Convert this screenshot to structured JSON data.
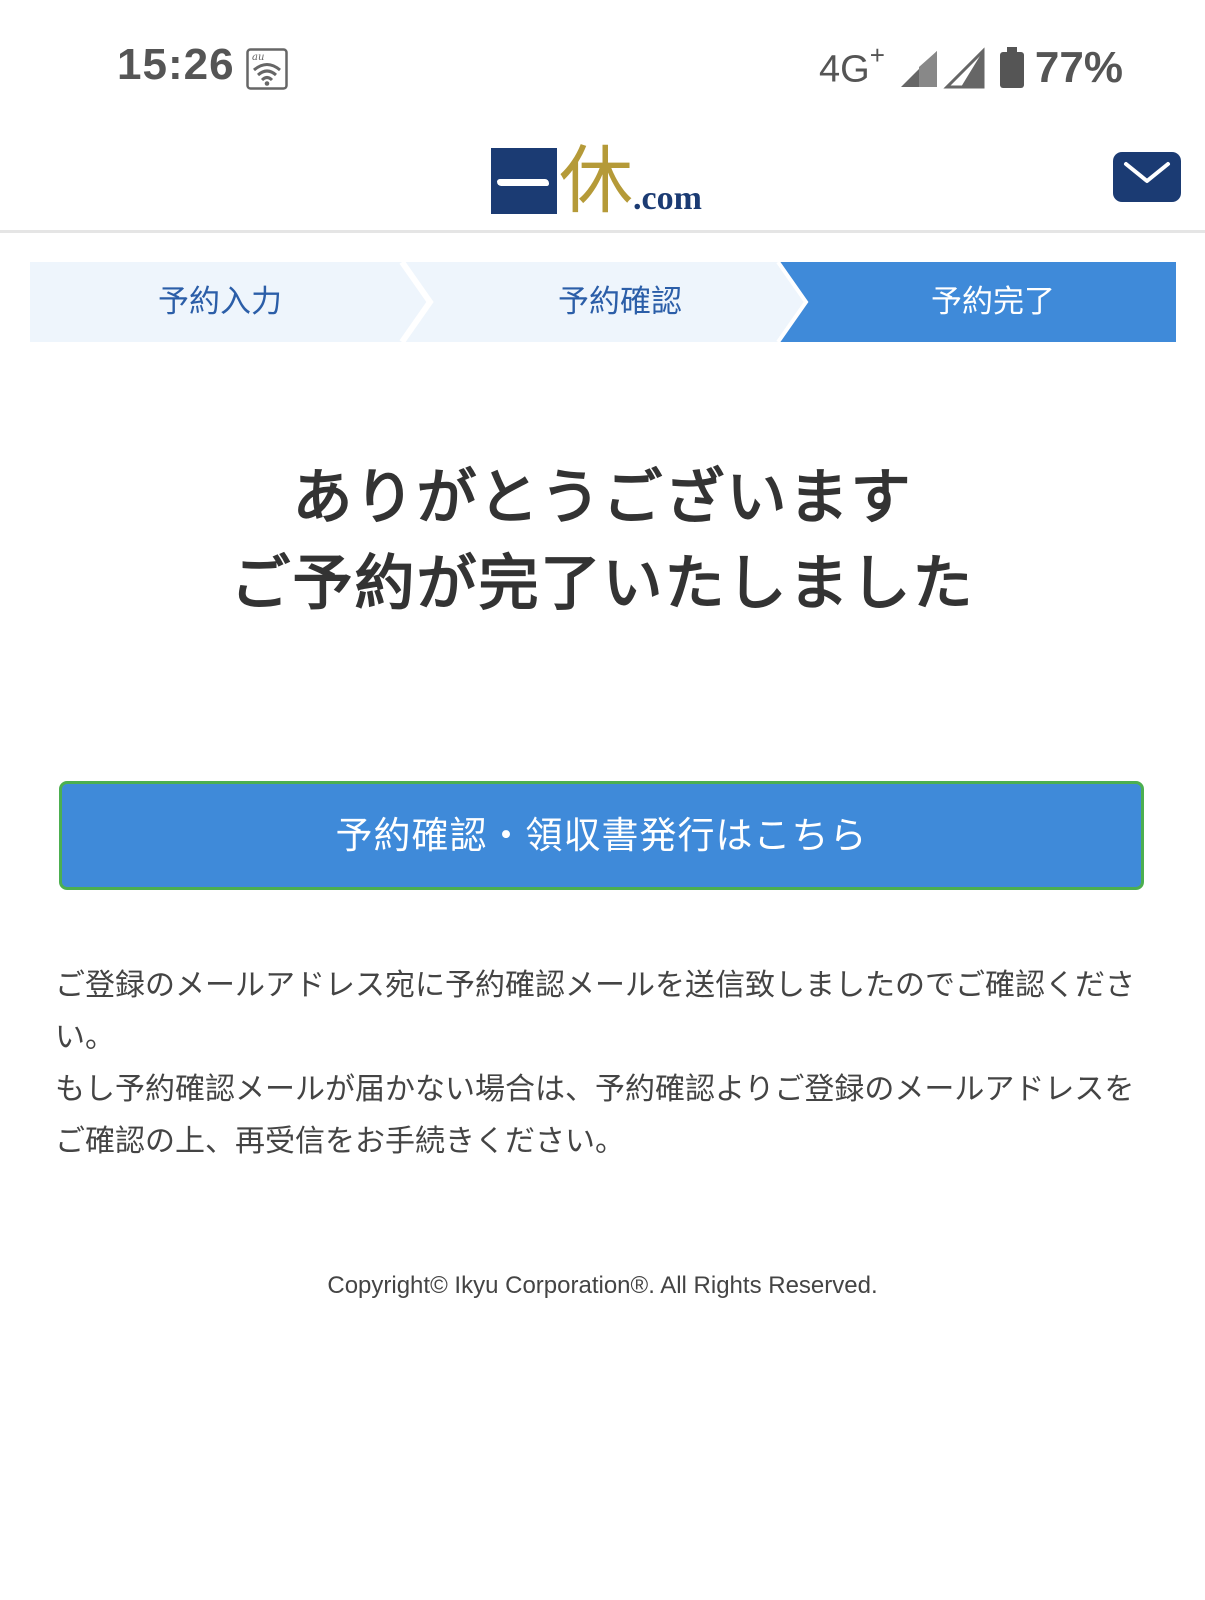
{
  "status_bar": {
    "time": "15:26",
    "carrier_badge": "au",
    "network": "4G",
    "network_plus": "+",
    "battery": "77%"
  },
  "header": {
    "logo": {
      "kanji": "休",
      "suffix": ".com"
    },
    "mail_icon": "envelope-icon"
  },
  "steps": [
    {
      "label": "予約入力",
      "active": false
    },
    {
      "label": "予約確認",
      "active": false
    },
    {
      "label": "予約完了",
      "active": true
    }
  ],
  "thanks": {
    "line1": "ありがとうございます",
    "line2": "ご予約が完了いたしました"
  },
  "cta": {
    "label": "予約確認・領収書発行はこちら"
  },
  "notice": {
    "paragraph1": "ご登録のメールアドレス宛に予約確認メールを送信致しましたのでご確認ください。",
    "paragraph2": "もし予約確認メールが届かない場合は、予約確認よりご登録のメールアドレスをご確認の上、再受信をお手続きください。"
  },
  "footer": {
    "copyright": "Copyright© Ikyu Corporation®. All Rights Reserved."
  },
  "colors": {
    "brand_navy": "#1b3b73",
    "brand_gold": "#b59a38",
    "accent_blue": "#3f8ad9",
    "step_inactive_bg": "#eef5fc",
    "cta_border": "#4caf50"
  }
}
